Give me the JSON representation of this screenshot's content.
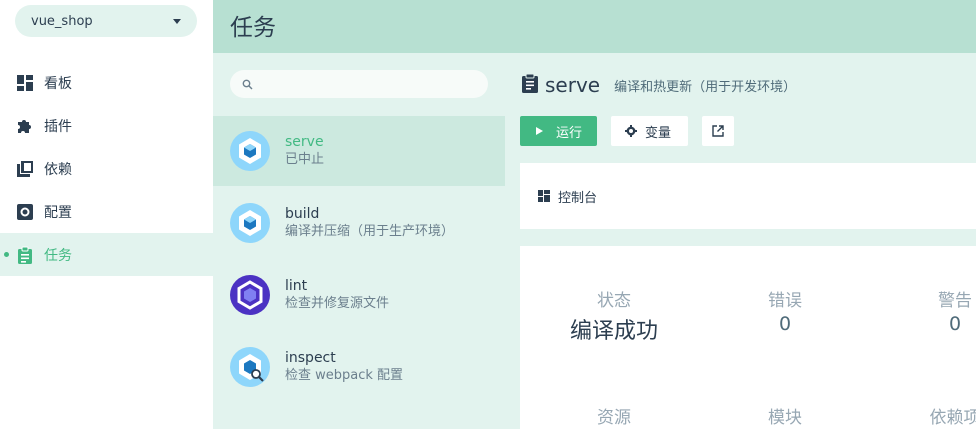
{
  "sidebar": {
    "project": "vue_shop",
    "items": [
      {
        "label": "看板",
        "icon": "dashboard-icon"
      },
      {
        "label": "插件",
        "icon": "puzzle-icon"
      },
      {
        "label": "依赖",
        "icon": "library-icon"
      },
      {
        "label": "配置",
        "icon": "settings-box-icon"
      },
      {
        "label": "任务",
        "icon": "clipboard-icon",
        "active": true
      }
    ]
  },
  "header": {
    "title": "任务"
  },
  "tasks": {
    "search_placeholder": "",
    "items": [
      {
        "name": "serve",
        "desc": "已中止",
        "icon": "webpack-icon",
        "selected": true
      },
      {
        "name": "build",
        "desc": "编译并压缩（用于生产环境）",
        "icon": "webpack-icon"
      },
      {
        "name": "lint",
        "desc": "检查并修复源文件",
        "icon": "eslint-icon"
      },
      {
        "name": "inspect",
        "desc": "检查 webpack 配置",
        "icon": "webpack-inspect-icon"
      }
    ]
  },
  "main": {
    "title": "serve",
    "subtitle": "编译和热更新（用于开发环境）",
    "run_label": "运行",
    "vars_label": "变量",
    "console_label": "控制台",
    "stats": [
      {
        "label": "状态",
        "value": "编译成功"
      },
      {
        "label": "错误",
        "value": "0"
      },
      {
        "label": "警告",
        "value": "0"
      },
      {
        "label": "资源",
        "value": ""
      },
      {
        "label": "模块",
        "value": ""
      },
      {
        "label": "依赖项",
        "value": ""
      }
    ]
  },
  "colors": {
    "accent": "#42b983",
    "header": "#b7e0d2",
    "panel": "#e2f3ee"
  }
}
